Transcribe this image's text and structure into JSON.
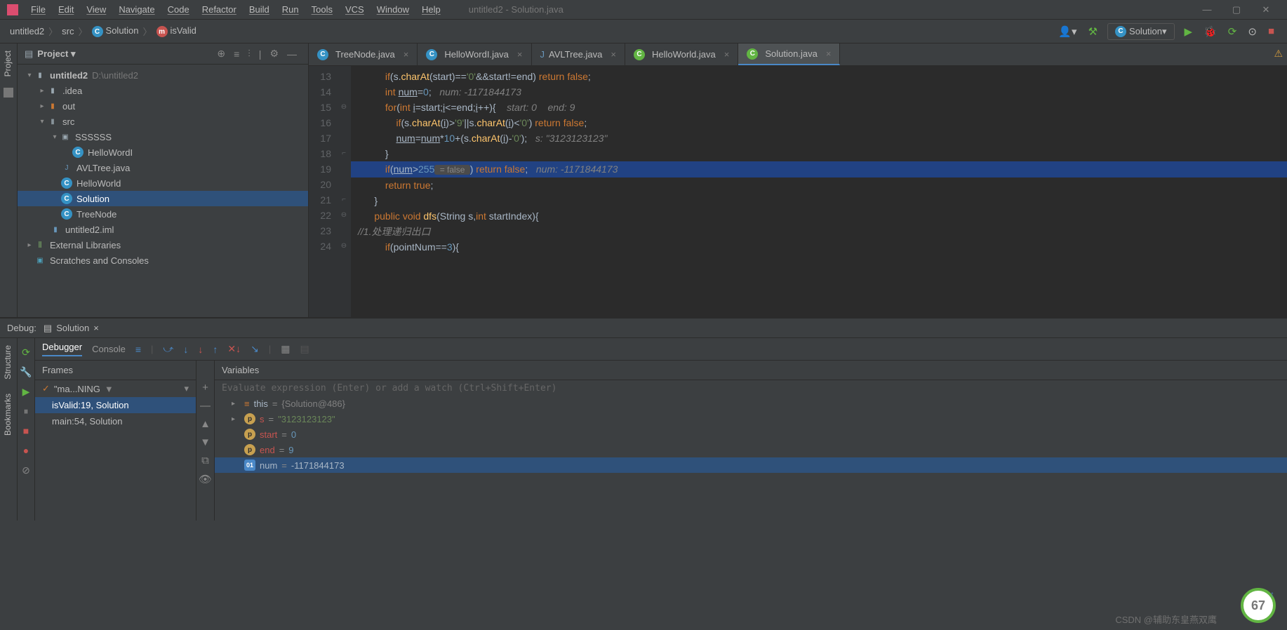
{
  "menubar": {
    "items": [
      "File",
      "Edit",
      "View",
      "Navigate",
      "Code",
      "Refactor",
      "Build",
      "Run",
      "Tools",
      "VCS",
      "Window",
      "Help"
    ],
    "title": "untitled2 - Solution.java"
  },
  "breadcrumb": {
    "project": "untitled2",
    "folder": "src",
    "class": "Solution",
    "method": "isValid"
  },
  "runConfig": "Solution",
  "projectPanel": {
    "title": "Project",
    "root": "untitled2",
    "rootPath": "D:\\untitled2",
    "idea": ".idea",
    "out": "out",
    "src": "src",
    "pkg": "SSSSSS",
    "helloWordI": "HelloWordI",
    "avlTree": "AVLTree.java",
    "helloWorld": "HelloWorld",
    "solution": "Solution",
    "treeNode": "TreeNode",
    "iml": "untitled2.iml",
    "extLib": "External Libraries",
    "scratches": "Scratches and Consoles"
  },
  "tabs": {
    "t0": "TreeNode.java",
    "t1": "HelloWordI.java",
    "t2": "AVLTree.java",
    "t3": "HelloWorld.java",
    "t4": "Solution.java"
  },
  "code": {
    "lines": {
      "13": "13",
      "14": "14",
      "15": "15",
      "16": "16",
      "17": "17",
      "18": "18",
      "19": "19",
      "20": "20",
      "21": "21",
      "22": "22",
      "23": "23",
      "24": "24"
    },
    "l13_a": "if",
    "l13_b": "(s.",
    "l13_c": "charAt",
    "l13_d": "(start)==",
    "l13_e": "'0'",
    "l13_f": "&&start!=end) ",
    "l13_g": "return false",
    "l13_h": ";",
    "l14_a": "int ",
    "l14_b": "num",
    "l14_c": "=",
    "l14_d": "0",
    "l14_e": ";",
    "l14_inlay": "num: -1171844173",
    "l15_a": "for",
    "l15_b": "(",
    "l15_c": "int ",
    "l15_d": "i",
    "l15_e": "=start;",
    "l15_f": "i",
    "l15_g": "<=end;",
    "l15_h": "i",
    "l15_i": "++){ ",
    "l15_inlay1": "start: 0",
    "l15_inlay2": "end: 9",
    "l16_a": "if",
    "l16_b": "(s.",
    "l16_c": "charAt",
    "l16_d": "(",
    "l16_e": "i",
    "l16_f": ")>",
    "l16_g": "'9'",
    "l16_h": "||s.",
    "l16_i": "charAt",
    "l16_j": "(",
    "l16_k": "i",
    "l16_l": ")<",
    "l16_m": "'0'",
    "l16_n": ") ",
    "l16_o": "return false",
    "l16_p": ";",
    "l17_a": "num",
    "l17_b": "=",
    "l17_c": "num",
    "l17_d": "*",
    "l17_e": "10",
    "l17_f": "+(s.",
    "l17_g": "charAt",
    "l17_h": "(",
    "l17_i": "i",
    "l17_j": ")-",
    "l17_k": "'0'",
    "l17_l": ");",
    "l17_inlay": "s: \"3123123123\"",
    "l18": "}",
    "l19_a": "if",
    "l19_b": "(",
    "l19_c": "num",
    "l19_d": ">",
    "l19_e": "255",
    "l19_inlay": " = false ",
    "l19_f": ") ",
    "l19_g": "return false",
    "l19_h": ";",
    "l19_inlay2": "num: -1171844173",
    "l20_a": "return true",
    "l20_b": ";",
    "l21": "}",
    "l22_a": "public void ",
    "l22_b": "dfs",
    "l22_c": "(String s,",
    "l22_d": "int ",
    "l22_e": "startIndex){",
    "l23": "//1.处理递归出口",
    "l24_a": "if",
    "l24_b": "(pointNum==",
    "l24_c": "3",
    "l24_d": "){"
  },
  "debug": {
    "label": "Debug:",
    "tabName": "Solution",
    "debuggerTab": "Debugger",
    "consoleTab": "Console",
    "framesHdr": "Frames",
    "variablesHdr": "Variables",
    "thread": "\"ma...NING",
    "frame0": "isValid:19, Solution",
    "frame1": "main:54, Solution",
    "evalPlaceholder": "Evaluate expression (Enter) or add a watch (Ctrl+Shift+Enter)",
    "thisVar": "this",
    "thisVal": "{Solution@486}",
    "sVar": "s",
    "sVal": "\"3123123123\"",
    "startVar": "start",
    "startVal": "0",
    "endVar": "end",
    "endVal": "9",
    "numVar": "num",
    "numVal": "-1171844173",
    "eq": " = "
  },
  "sideTabs": {
    "project": "Project",
    "structure": "Structure",
    "bookmarks": "Bookmarks"
  },
  "watermark": "CSDN @辅助东皇燕双鹰",
  "badge": "67"
}
